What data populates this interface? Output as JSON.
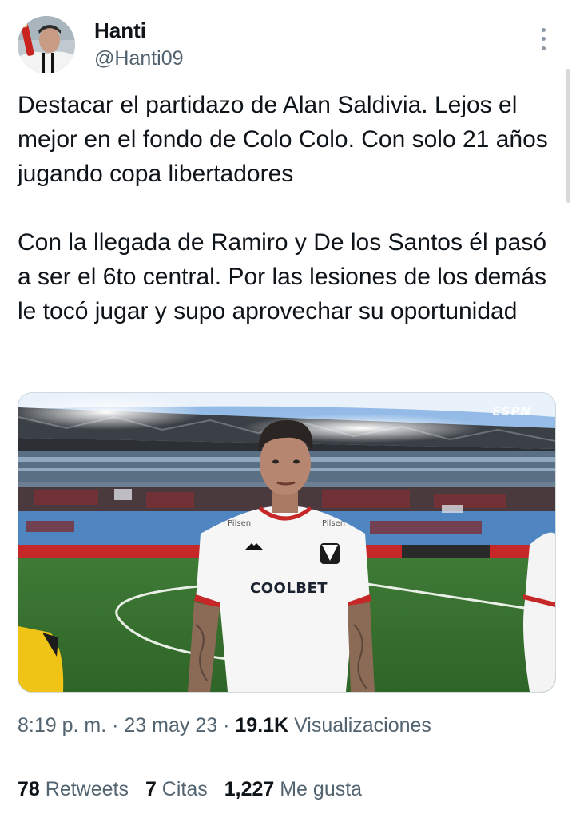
{
  "author": {
    "display_name": "Hanti",
    "handle": "@Hanti09",
    "avatar_icon": "user-avatar"
  },
  "more_icon": "more-vertical-icon",
  "tweet": {
    "paragraphs": [
      "Destacar el partidazo de Alan Saldivia. Lejos el mejor en el fondo de Colo Colo. Con solo 21 años jugando copa libertadores",
      "Con la llegada de Ramiro y De los Santos él pasó a ser el 6to central. Por las lesiones de los demás le tocó jugar y supo aprovechar su oportunidad"
    ]
  },
  "media": {
    "broadcaster_logo": "ESPN",
    "shirt_sponsor": "COOLBET"
  },
  "meta": {
    "time": "8:19 p. m.",
    "date": "23 may 23",
    "views_count": "19.1K",
    "views_label": "Visualizaciones",
    "separator": "·"
  },
  "stats": {
    "retweets_count": "78",
    "retweets_label": "Retweets",
    "quotes_count": "7",
    "quotes_label": "Citas",
    "likes_count": "1,227",
    "likes_label": "Me gusta"
  },
  "colors": {
    "text_primary": "#0f1419",
    "text_secondary": "#536471",
    "divider": "#e1e6ea"
  }
}
